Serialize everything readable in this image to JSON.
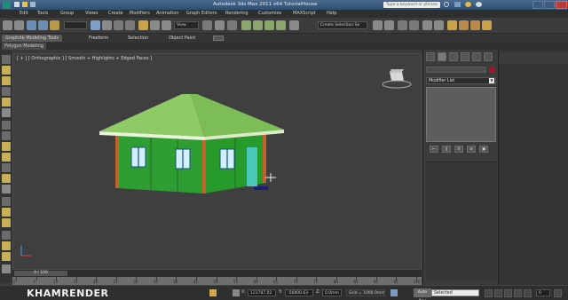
{
  "window": {
    "title": "Autodesk 3ds Max  2011 x64   TutorialHouse",
    "search_placeholder": "Type a keyword or phrase"
  },
  "menu": [
    "Edit",
    "Tools",
    "Group",
    "Views",
    "Create",
    "Modifiers",
    "Animation",
    "Graph Editors",
    "Rendering",
    "Customize",
    "MAXScript",
    "Help"
  ],
  "toolbar": {
    "view_dropdown": "View",
    "selection_set": "Create Selection Se"
  },
  "ribbon": {
    "tabs": [
      "Graphite Modeling Tools",
      "Freeform",
      "Selection",
      "Object Paint"
    ],
    "subtab": "Polygon Modeling"
  },
  "viewport": {
    "label": "[ + ] [ Orthographic ] [ Smooth + Highlights + Edged Faces ]",
    "colors": {
      "roof": "#8ecb66",
      "walls": "#2e9e32",
      "trim": "#c4622a",
      "window": "#d0f0ff"
    }
  },
  "timeline": {
    "slider": "0 / 100"
  },
  "trackbar": {
    "ticks": [
      "0",
      "5",
      "10",
      "15",
      "20",
      "25",
      "30",
      "35",
      "40",
      "45",
      "50",
      "55",
      "60",
      "65",
      "70",
      "75",
      "80",
      "85",
      "90",
      "95",
      "100"
    ]
  },
  "command_panel": {
    "modifier_list": "Modifier List",
    "object_color": "#a3142a"
  },
  "status": {
    "logo": "KHAMRENDER",
    "x_value": "121787.02",
    "y_value": "-56800.63",
    "z_value": "0.0mm",
    "grid": "Grid = 1000.0mm",
    "auto_key": "Auto Key",
    "selected": "Selected",
    "frame": "0"
  }
}
